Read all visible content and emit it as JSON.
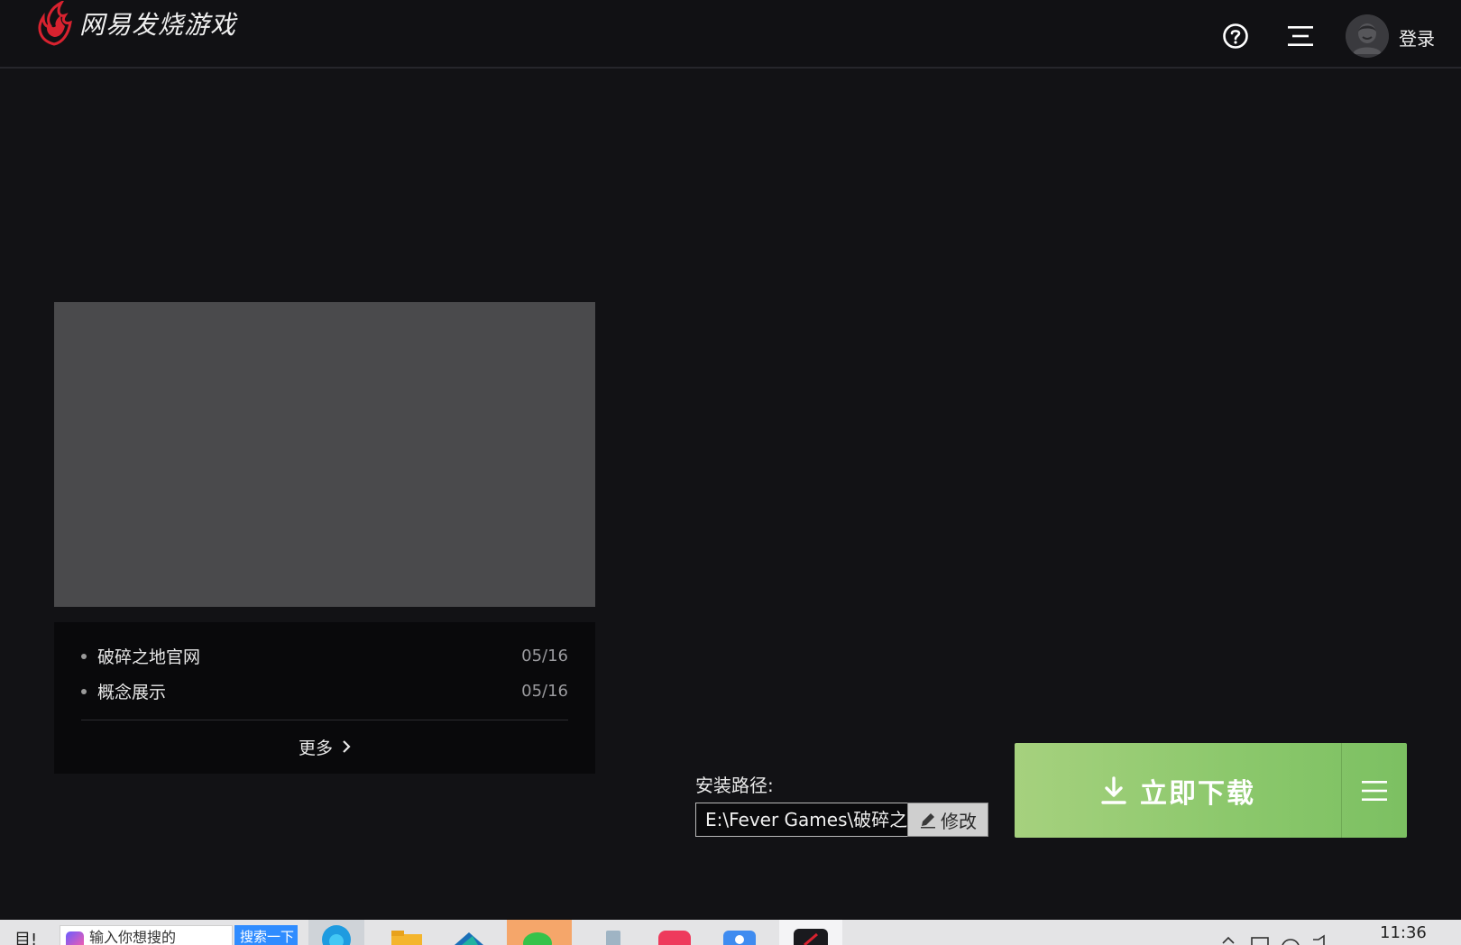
{
  "header": {
    "logo_text": "网易发烧游戏",
    "login_label": "登录"
  },
  "news": {
    "items": [
      {
        "title": "破碎之地官网",
        "date": "05/16"
      },
      {
        "title": "概念展示",
        "date": "05/16"
      }
    ],
    "more_label": "更多"
  },
  "install": {
    "label": "安装路径:",
    "path": "E:\\Fever Games\\破碎之",
    "modify_label": "修改"
  },
  "download": {
    "label": "立即下载"
  },
  "taskbar": {
    "start_text": "目!",
    "search_placeholder": "输入你想搜的",
    "search_button": "搜索一下",
    "clock": "11:36"
  },
  "colors": {
    "accent_green": "#8cc86c",
    "logo_red": "#d8222f",
    "background": "#121215",
    "media_placeholder": "#4a4a4c"
  },
  "icons": {
    "logo": "netease-flame-logo",
    "help": "help-circle-icon",
    "menu": "menu-icon",
    "avatar": "user-avatar-icon",
    "download": "download-arrow-icon",
    "edit": "pencil-icon",
    "more": "chevron-right-icon"
  }
}
